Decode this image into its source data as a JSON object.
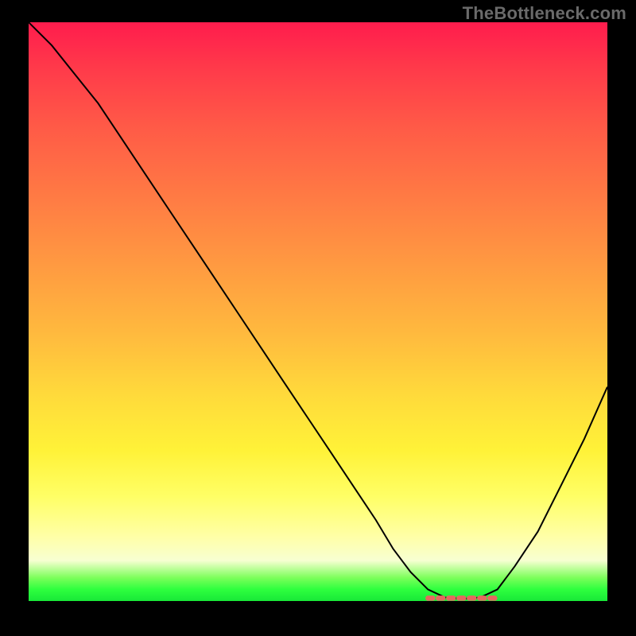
{
  "watermark": "TheBottleneck.com",
  "chart_data": {
    "type": "line",
    "title": "",
    "xlabel": "",
    "ylabel": "",
    "xlim": [
      0,
      100
    ],
    "ylim": [
      0,
      100
    ],
    "grid": false,
    "series": [
      {
        "name": "bottleneck-curve",
        "x": [
          0,
          4,
          8,
          12,
          16,
          20,
          24,
          28,
          32,
          36,
          40,
          44,
          48,
          52,
          56,
          60,
          63,
          66,
          69,
          72,
          75,
          78,
          81,
          84,
          88,
          92,
          96,
          100
        ],
        "y": [
          100,
          96,
          91,
          86,
          80,
          74,
          68,
          62,
          56,
          50,
          44,
          38,
          32,
          26,
          20,
          14,
          9,
          5,
          2,
          0.6,
          0.4,
          0.6,
          2,
          6,
          12,
          20,
          28,
          37
        ]
      }
    ],
    "minimum_band": {
      "x_start": 69,
      "x_end": 81,
      "y": 0.5
    },
    "colors": {
      "gradient_top": "#ff1c4d",
      "gradient_mid": "#ffd93b",
      "gradient_bottom": "#18e838",
      "curve": "#000000",
      "marker": "#e4695f",
      "frame": "#000000"
    }
  }
}
